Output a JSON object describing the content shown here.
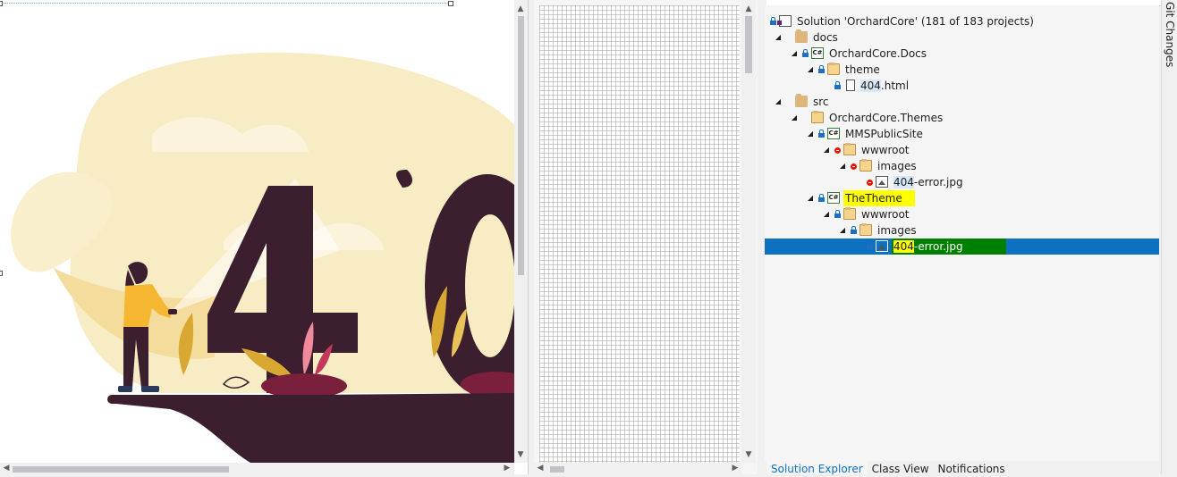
{
  "image_editor": {
    "artwork_text": "40",
    "accent_colors": {
      "plum": "#3b1f2f",
      "cream": "#f7e9b8",
      "sun": "#f4d88e",
      "shirt": "#f5b731",
      "leaf": "#d8a832",
      "pink": "#f28a9e",
      "berry": "#7a1f3c"
    }
  },
  "solution_explorer": {
    "items": [
      {
        "label": "Solution 'OrchardCore' (181 of 183 projects)",
        "icon": "solution-icon"
      },
      {
        "label": "docs",
        "icon": "folder-icon"
      },
      {
        "label": "OrchardCore.Docs",
        "icon": "csharp-project-icon"
      },
      {
        "label": "theme",
        "icon": "folder-open-icon"
      },
      {
        "label_highlight": "404",
        "label_rest": ".html",
        "icon": "html-file-icon"
      },
      {
        "label": "src",
        "icon": "folder-icon"
      },
      {
        "label": "OrchardCore.Themes",
        "icon": "folder-open-icon"
      },
      {
        "label": "MMSPublicSite",
        "icon": "csharp-project-icon"
      },
      {
        "label": "wwwroot",
        "icon": "folder-open-icon"
      },
      {
        "label": "images",
        "icon": "folder-open-icon"
      },
      {
        "label_highlight": "404",
        "label_rest": "-error.jpg",
        "icon": "image-file-icon"
      },
      {
        "label": "TheTheme",
        "icon": "csharp-project-icon"
      },
      {
        "label": "wwwroot",
        "icon": "folder-open-icon"
      },
      {
        "label": "images",
        "icon": "folder-open-icon"
      },
      {
        "label_highlight": "404",
        "label_rest": "-error.jpg",
        "icon": "image-file-icon"
      }
    ],
    "csharp_badge": "C#"
  },
  "bottom_tabs": [
    "Solution Explorer",
    "Class View",
    "Notifications"
  ],
  "side_tab": "Git Changes",
  "colors": {
    "selection_blue": "#0e70c0",
    "find_green": "#008000",
    "find_yellow": "#ffff00",
    "pending_red": "#e51400",
    "lock_blue": "#1b70c4"
  }
}
